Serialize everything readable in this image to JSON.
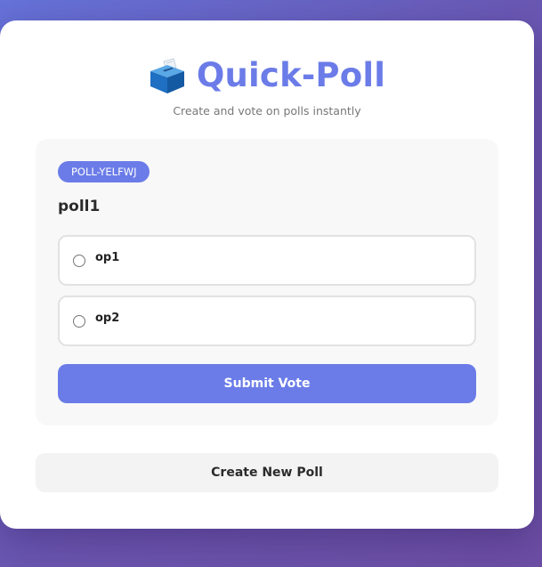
{
  "app": {
    "icon": "ballot-box-icon",
    "title": "Quick-Poll",
    "subtitle": "Create and vote on polls instantly"
  },
  "poll": {
    "id": "POLL-YELFWJ",
    "question": "poll1",
    "options": [
      {
        "label": "op1",
        "selected": false
      },
      {
        "label": "op2",
        "selected": false
      }
    ],
    "submit_label": "Submit Vote"
  },
  "actions": {
    "create_label": "Create New Poll"
  },
  "colors": {
    "accent": "#6b7ce8",
    "background_start": "#6673d9",
    "background_end": "#6c4ea3"
  }
}
